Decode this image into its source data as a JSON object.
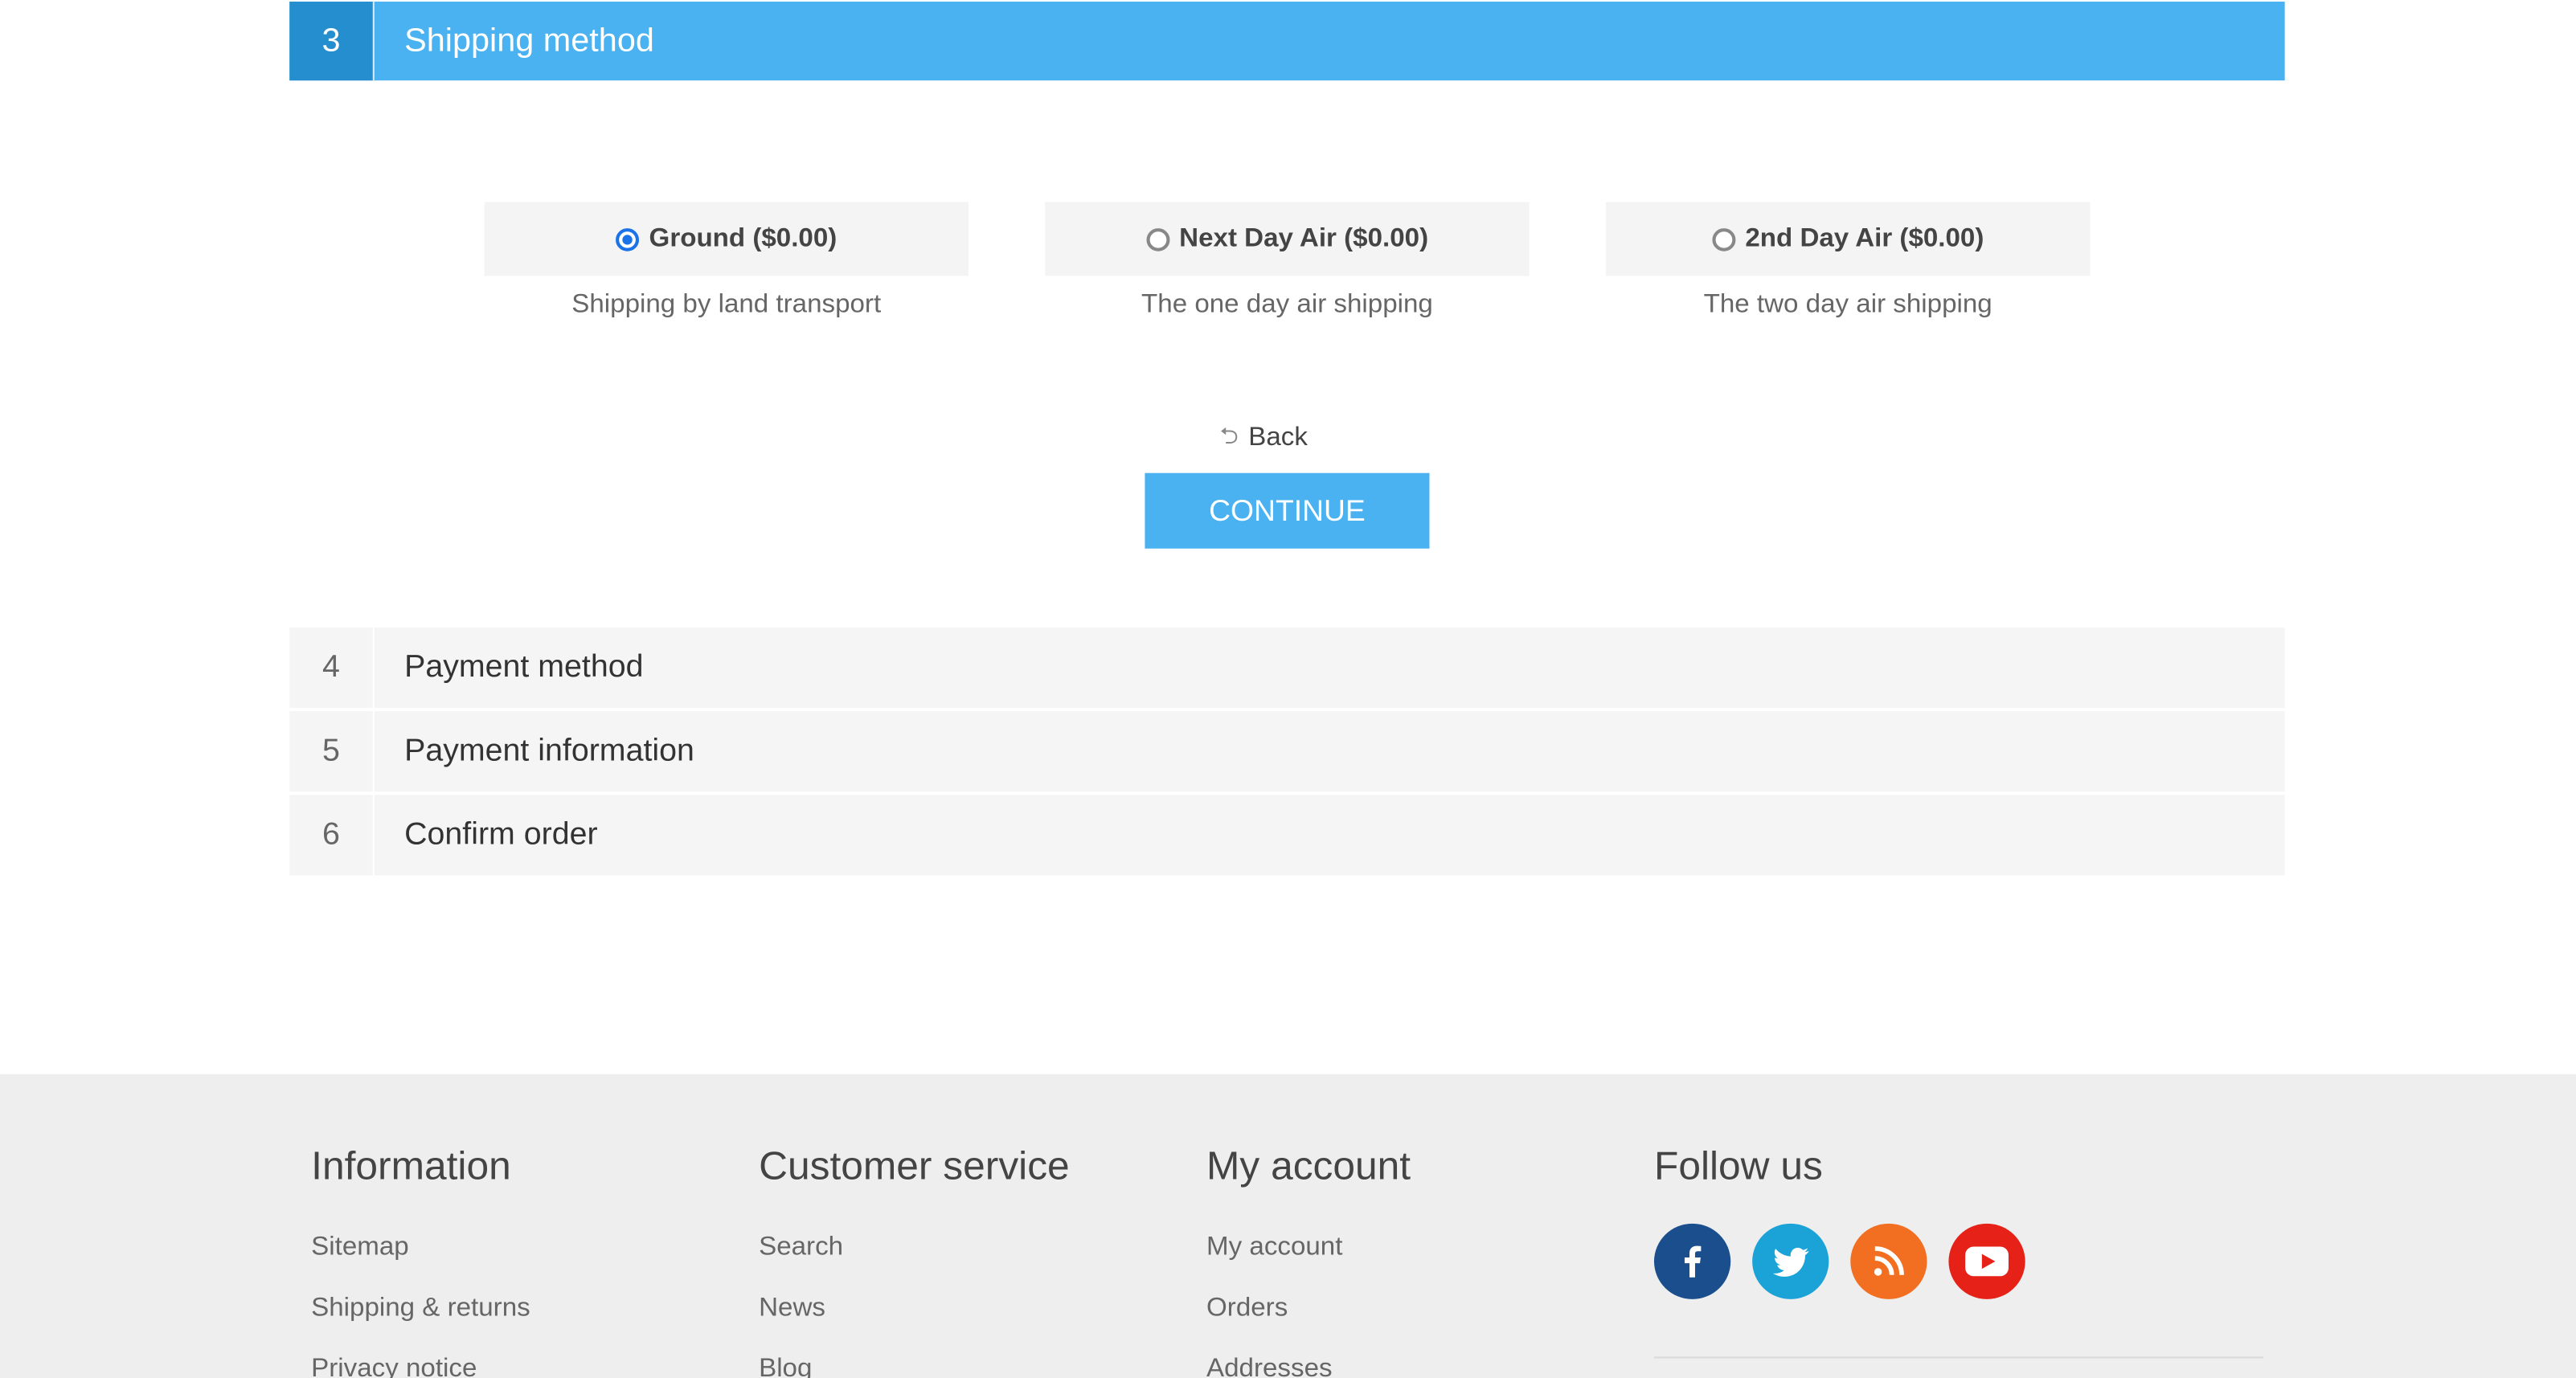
{
  "shipping_step": {
    "number": "3",
    "title": "Shipping method"
  },
  "shipping_options": [
    {
      "label": "Ground ($0.00)",
      "description": "Shipping by land transport",
      "selected": true
    },
    {
      "label": "Next Day Air ($0.00)",
      "description": "The one day air shipping",
      "selected": false
    },
    {
      "label": "2nd Day Air ($0.00)",
      "description": "The two day air shipping",
      "selected": false
    }
  ],
  "actions": {
    "back_label": "Back",
    "back_icon": "back-arrow-icon",
    "continue_label": "CONTINUE"
  },
  "steps": [
    {
      "number": "4",
      "title": "Payment method"
    },
    {
      "number": "5",
      "title": "Payment information"
    },
    {
      "number": "6",
      "title": "Confirm order"
    }
  ],
  "footer": {
    "information": {
      "title": "Information",
      "links": [
        "Sitemap",
        "Shipping & returns",
        "Privacy notice"
      ]
    },
    "customer_service": {
      "title": "Customer service",
      "links": [
        "Search",
        "News",
        "Blog"
      ]
    },
    "my_account": {
      "title": "My account",
      "links": [
        "My account",
        "Orders",
        "Addresses"
      ]
    },
    "follow_us": {
      "title": "Follow us",
      "networks": [
        {
          "name": "facebook-icon",
          "color": "#1a4e8d"
        },
        {
          "name": "twitter-icon",
          "color": "#1ba3d8"
        },
        {
          "name": "rss-icon",
          "color": "#f26e21"
        },
        {
          "name": "youtube-icon",
          "color": "#e62117"
        }
      ]
    }
  },
  "colors": {
    "accent": "#4ab2f1",
    "accent_dark": "#248ece",
    "radio_selected": "#1a73e8"
  }
}
